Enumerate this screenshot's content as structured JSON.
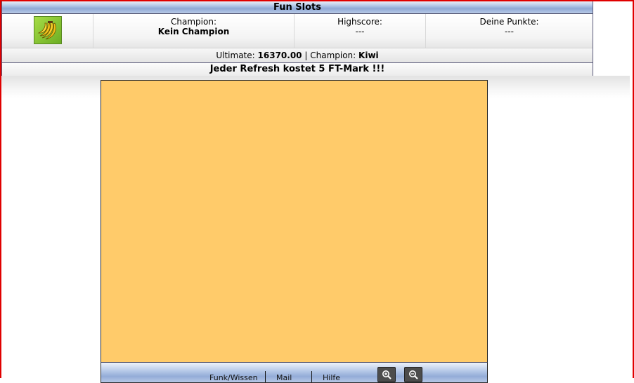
{
  "header": {
    "title": "Fun Slots",
    "logo_icon": "banana-icon",
    "champion_label": "Champion:",
    "champion_value": "Kein Champion",
    "highscore_label": "Highscore:",
    "highscore_value": "---",
    "points_label": "Deine Punkte:",
    "points_value": "---"
  },
  "ultimate": {
    "label": "Ultimate:",
    "value": "16370.00",
    "separator": "|",
    "champion_label": "Champion:",
    "champion_value": "Kiwi"
  },
  "notice": "Jeder Refresh kostet 5 FT-Mark !!!",
  "game": {
    "background_color": "#ffcb6a",
    "toolbar": {
      "link1": "Funk/Wissen",
      "link2": "Mail",
      "link3": "Hilfe",
      "zoom_in_icon": "zoom-in-icon",
      "zoom_out_icon": "zoom-out-icon"
    }
  },
  "colors": {
    "frame_border": "#e00000",
    "bar_blue": "#8fa9d6"
  }
}
